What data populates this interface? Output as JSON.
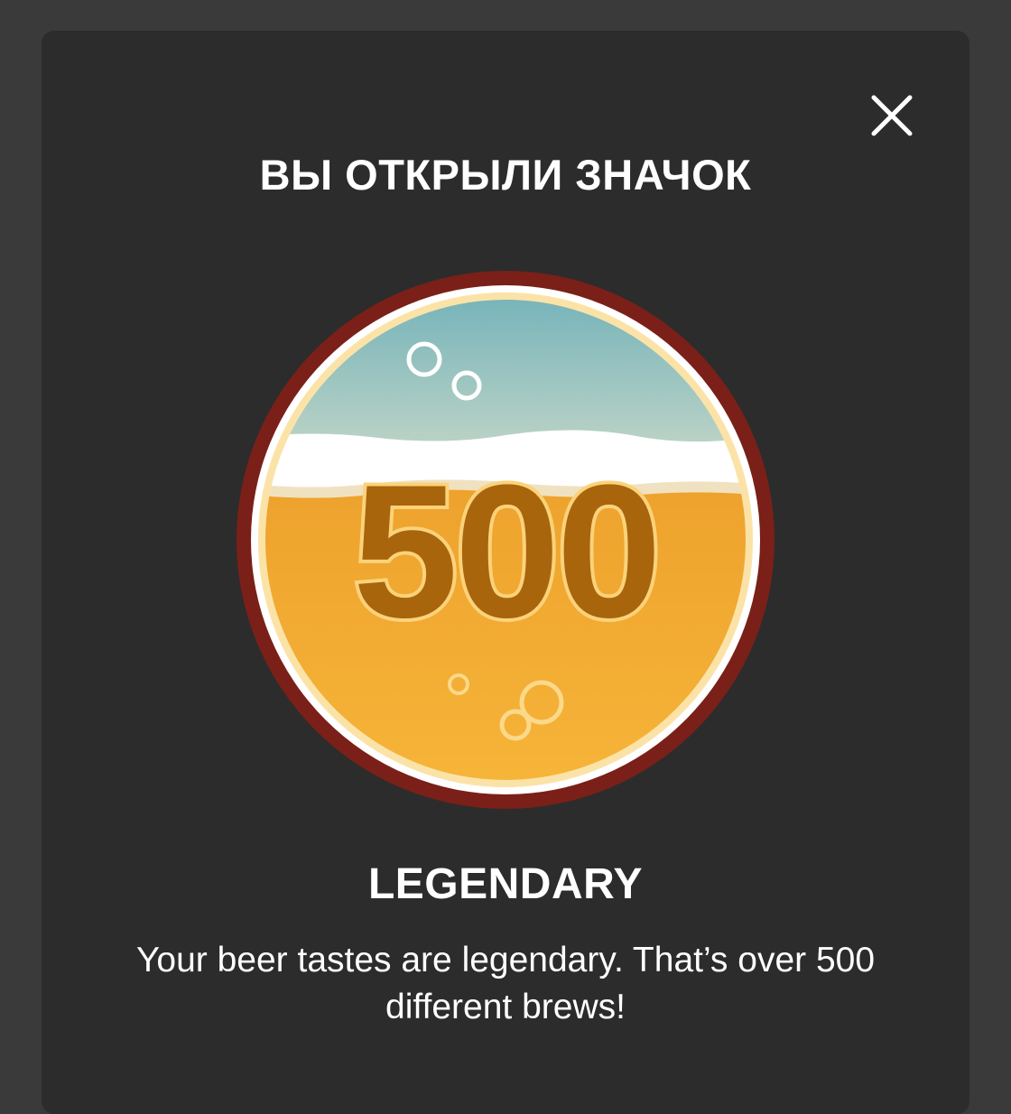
{
  "modal": {
    "title": "ВЫ ОТКРЫЛИ ЗНАЧОК",
    "close_icon": "close-icon",
    "badge": {
      "image_icon": "beer-glass-badge-icon",
      "number": "500",
      "name": "LEGENDARY",
      "description": "Your beer tastes are legendary. That’s over 500 different brews!"
    }
  },
  "colors": {
    "background": "#3a3a3a",
    "modal": "#2c2c2c",
    "badge_ring": "#7a2018",
    "badge_beer": "#f0a830",
    "badge_number": "#a8650c"
  }
}
